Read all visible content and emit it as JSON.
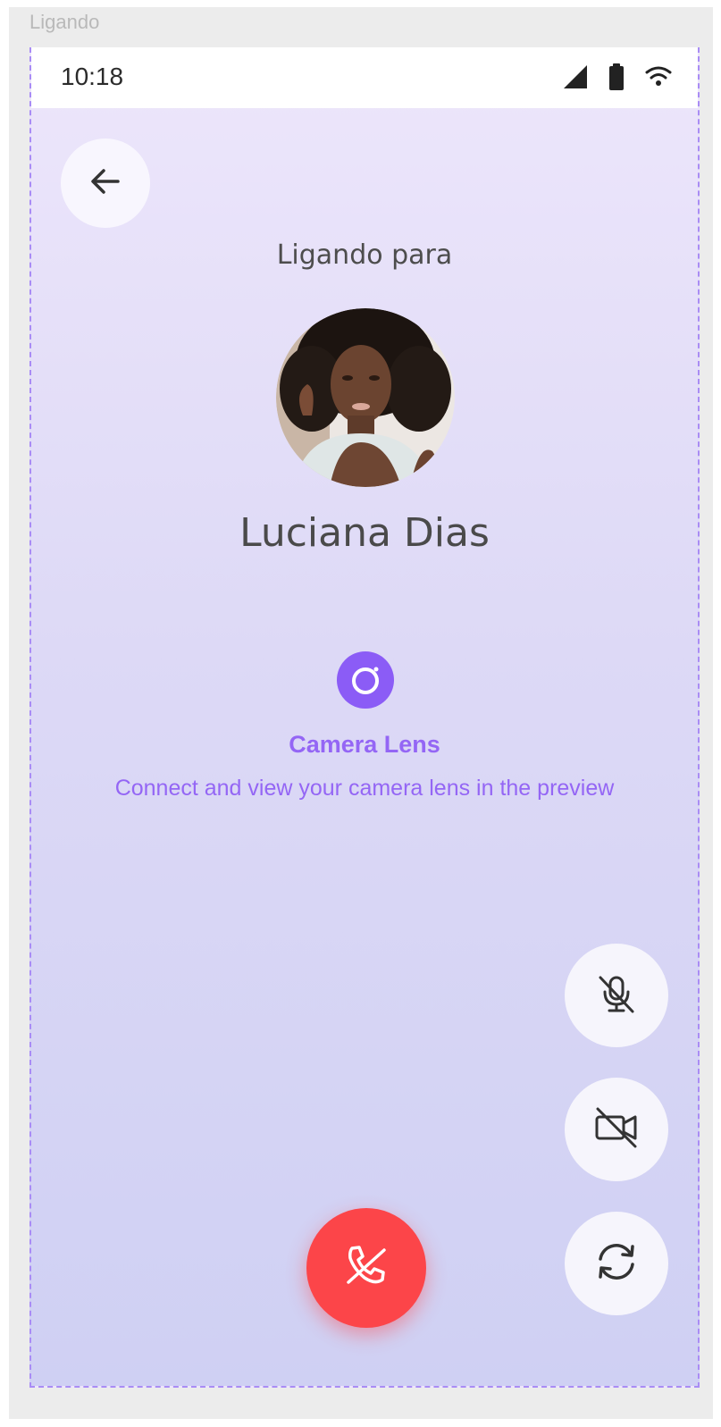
{
  "frame": {
    "label": "Ligando"
  },
  "status_bar": {
    "time": "10:18",
    "icons": [
      "signal-icon",
      "battery-icon",
      "wifi-icon"
    ]
  },
  "call": {
    "calling_label": "Ligando para",
    "contact_name": "Luciana Dias"
  },
  "camera_lens": {
    "title": "Camera Lens",
    "description": "Connect and view your camera lens in the preview"
  },
  "controls": {
    "icons": [
      "back-arrow-icon",
      "mic-off-icon",
      "video-off-icon",
      "camera-flip-icon",
      "end-call-icon"
    ]
  },
  "colors": {
    "accent": "#8b5cf6",
    "hangup": "#fc4549",
    "background_top": "#ede6fb",
    "background_bottom": "#cfd0f3"
  }
}
